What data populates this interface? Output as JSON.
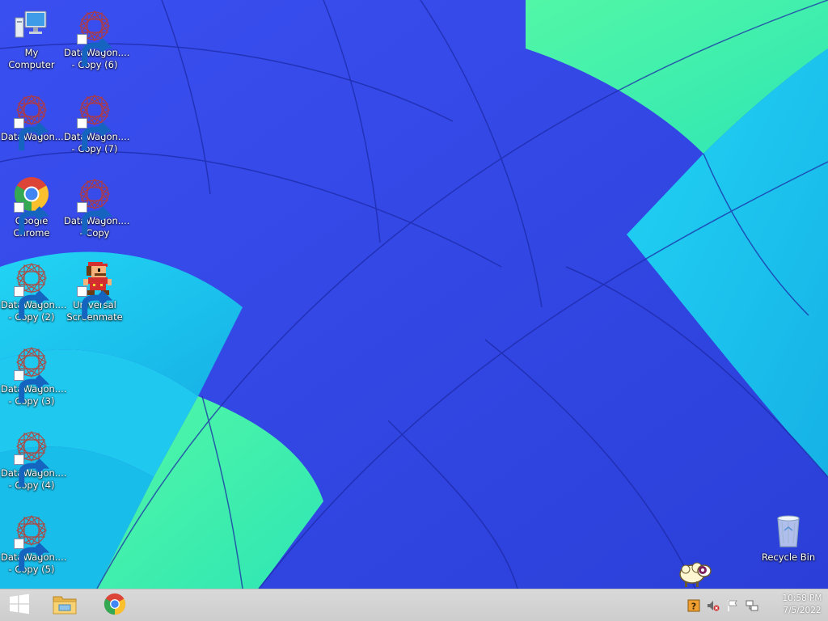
{
  "desktop": {
    "icons": [
      {
        "label": "My Computer"
      },
      {
        "label": "DataWagon....\n- Copy (6)"
      },
      {
        "label": "DataWagon..."
      },
      {
        "label": "DataWagon....\n- Copy (7)"
      },
      {
        "label": "Google\nChrome"
      },
      {
        "label": "DataWagon....\n- Copy"
      },
      {
        "label": "DataWagon....\n- Copy (2)"
      },
      {
        "label": "Universal\nScreenmate"
      },
      {
        "label": "DataWagon....\n- Copy (3)"
      },
      {
        "label": "DataWagon....\n- Copy (4)"
      },
      {
        "label": "DataWagon....\n- Copy (5)"
      },
      {
        "label": "Recycle Bin"
      }
    ]
  },
  "taskbar": {
    "start_icon": "windows-logo-icon",
    "pinned": [
      "file-explorer-icon",
      "chrome-icon"
    ],
    "tray": [
      "help-icon",
      "volume-muted-icon",
      "action-center-flag-icon",
      "network-icon"
    ],
    "clock": {
      "time": "10:58 PM",
      "date": "7/5/2022"
    }
  },
  "colors": {
    "taskbar": "#d2d2d2",
    "wallpaper_blue": "#2f49e6",
    "wallpaper_cyan": "#1ec6ee",
    "wallpaper_green": "#3ef0a0"
  }
}
